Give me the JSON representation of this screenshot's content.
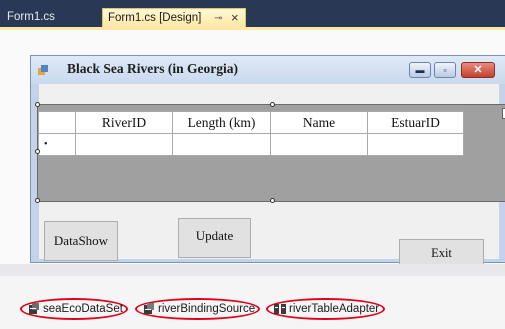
{
  "tabs": [
    {
      "label": "Form1.cs",
      "active": false
    },
    {
      "label": "Form1.cs [Design]",
      "active": true,
      "pin_icon": "pin-icon",
      "close_glyph": "×"
    }
  ],
  "form": {
    "title": "Black Sea Rivers (in Georgia)",
    "window_buttons": {
      "minimize": "▬",
      "maximize": "▫",
      "close": "✕"
    },
    "grid": {
      "columns": [
        "",
        "RiverID",
        "Length (km)",
        "Name",
        "EstuarID"
      ],
      "new_row_marker": "•",
      "smart_tag": "▸"
    },
    "buttons": {
      "datashow": "DataShow",
      "update": "Update",
      "exit": "Exit"
    }
  },
  "tray": {
    "components": [
      {
        "label": "seaEcoDataSet",
        "icon": "dataset-icon"
      },
      {
        "label": "riverBindingSource",
        "icon": "binding-source-icon"
      },
      {
        "label": "riverTableAdapter",
        "icon": "table-adapter-icon"
      }
    ]
  },
  "colors": {
    "ide_background": "#293955",
    "active_tab": "#ffe8a6",
    "form_frame": "#c3d4ea",
    "highlight_circle": "#e0001b"
  }
}
